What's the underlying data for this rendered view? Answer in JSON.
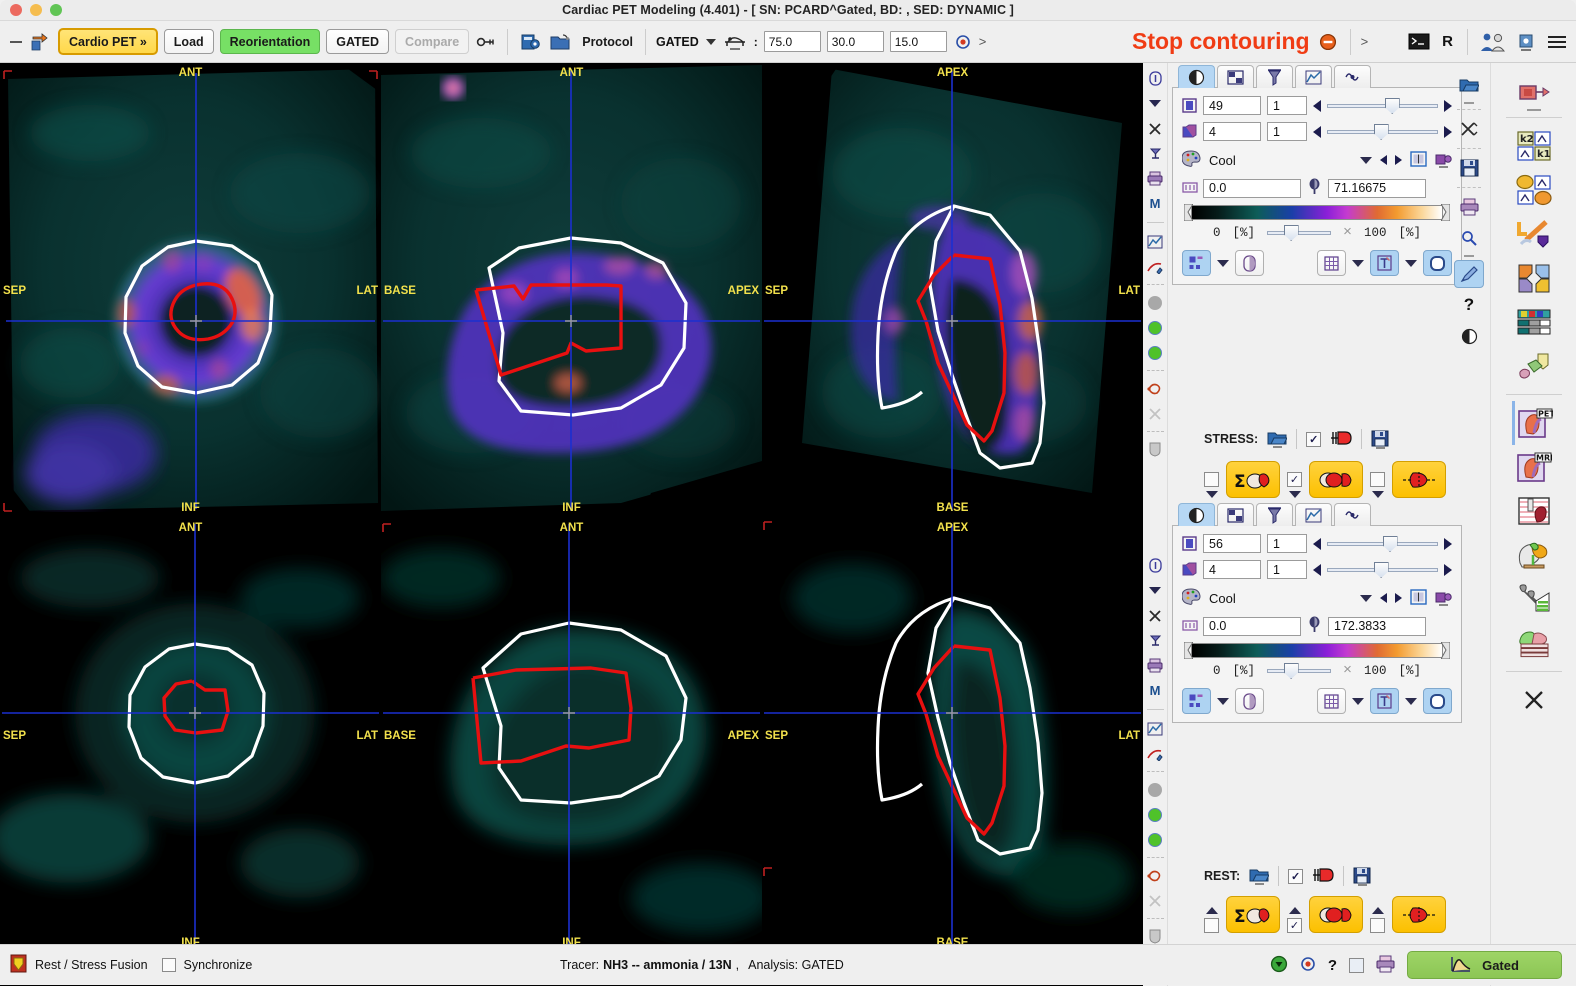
{
  "window": {
    "title": "Cardiac PET Modeling (4.401) - [ SN: PCARD^Gated, BD: , SED: DYNAMIC ]"
  },
  "toolbar": {
    "cardio_pet": "Cardio PET »",
    "load": "Load",
    "reorientation": "Reorientation",
    "gated": "GATED",
    "compare": "Compare",
    "protocol": "Protocol",
    "gated_select": "GATED",
    "colon": ":",
    "field1": "75.0",
    "field2": "30.0",
    "field3": "15.0",
    "chevron1": ">",
    "stop_contouring": "Stop contouring",
    "chevron2": ">",
    "r_label": "R",
    "icons": {
      "arrow_out": "arrow-out-icon",
      "link": "link-icon",
      "db_blue": "database-blue-icon",
      "folder_protocol": "folder-protocol-icon",
      "bed": "patient-bed-icon",
      "target": "target-icon",
      "stop": "stop-circle-icon",
      "terminal": "terminal-icon",
      "people": "people-icon",
      "help_q": "info-badge-icon",
      "hamburger": "hamburger-menu-icon"
    }
  },
  "images": {
    "row1": [
      {
        "name": "stress-short-axis",
        "top": "ANT",
        "bottom": "INF",
        "left": "SEP",
        "right": "LAT"
      },
      {
        "name": "stress-horizontal-long-axis",
        "top": "ANT",
        "bottom": "INF",
        "left": "BASE",
        "right": "APEX"
      },
      {
        "name": "stress-vertical-long-axis",
        "top": "APEX",
        "bottom": "BASE",
        "left": "SEP",
        "right": "LAT"
      }
    ],
    "row2": [
      {
        "name": "rest-short-axis",
        "top": "ANT",
        "bottom": "INF",
        "left": "SEP",
        "right": "LAT"
      },
      {
        "name": "rest-horizontal-long-axis",
        "top": "ANT",
        "bottom": "INF",
        "left": "BASE",
        "right": "APEX"
      },
      {
        "name": "rest-vertical-long-axis",
        "top": "APEX",
        "bottom": "BASE",
        "left": "SEP",
        "right": "LAT"
      }
    ]
  },
  "panel_stress": {
    "tabs": [
      "contrast-tab",
      "layout-tab",
      "filter-tab",
      "curve-tab",
      "fusion-tab"
    ],
    "active_tab_index": 0,
    "slice_value": "49",
    "slice_step": "1",
    "frame_value": "4",
    "frame_step": "1",
    "palette_name": "Cool",
    "min_value": "0.0",
    "max_value": "71.16675",
    "pct_min": "0",
    "pct_min_unit": "[%]",
    "pct_max": "100",
    "pct_max_unit": "[%]",
    "times": "×"
  },
  "panel_rest": {
    "tabs": [
      "contrast-tab",
      "layout-tab",
      "filter-tab",
      "curve-tab",
      "fusion-tab"
    ],
    "active_tab_index": 0,
    "slice_value": "56",
    "slice_step": "1",
    "frame_value": "4",
    "frame_step": "1",
    "palette_name": "Cool",
    "min_value": "0.0",
    "max_value": "172.3833",
    "pct_min": "0",
    "pct_min_unit": "[%]",
    "pct_max": "100",
    "pct_max_unit": "[%]",
    "times": "×"
  },
  "stress_row": {
    "label": "STRESS:",
    "open_icon": "folder-open-icon",
    "check_icon": "checkbox-checked-icon",
    "heart_seg_icon": "heart-segment-icon",
    "save_icon": "floppy-save-icon",
    "buttons": [
      "sum-heart-button",
      "contour-heart-button",
      "polar-heart-button"
    ]
  },
  "rest_row": {
    "label": "REST:",
    "open_icon": "folder-open-icon",
    "check_icon": "checkbox-checked-icon",
    "heart_seg_icon": "heart-segment-icon",
    "save_icon": "floppy-save-icon",
    "buttons": [
      "sum-heart-button",
      "contour-heart-button",
      "polar-heart-button"
    ]
  },
  "icon_rail": [
    "model-node-icon",
    "k2-k1-matrix-icon",
    "blob-network-icon",
    "tools-wrench-icon",
    "four-arrows-icon",
    "color-table-icon",
    "3d-shapes-icon",
    "pet-heart-icon",
    "mri-heart-icon",
    "perfusion-heart-icon",
    "brain-head-icon",
    "tree-chart-icon",
    "stack-layers-icon",
    "close-x-icon"
  ],
  "mid_rail": [
    "folder-open-icon",
    "scissors-icon",
    "floppy-save-icon",
    "printer-icon",
    "zoom-icon",
    "pen-tool-icon",
    "help-question-icon",
    "contrast-icon"
  ],
  "thin_rail": [
    "info-icon",
    "caret-down-icon",
    "close-x-icon",
    "lamp-icon",
    "printer-icon",
    "m-letter-icon",
    "curve-icon",
    "draw-icon",
    "gray-circle-icon",
    "green-circle-icon",
    "green-circle-icon",
    "contour-icon",
    "x-gray-icon",
    "shield-icon"
  ],
  "status": {
    "fusion_label": "Rest / Stress Fusion",
    "fusion_icon": "fusion-icon",
    "synchronize": "Synchronize",
    "tracer_label": "Tracer:",
    "tracer_value": "NH3 -- ammonia / 13N",
    "comma": ",",
    "analysis_label": "Analysis: GATED",
    "help": "?",
    "gated_button": "Gated",
    "icons": {
      "green_down": "green-down-circle-icon",
      "target": "target-icon",
      "checkbox": "checkbox-icon",
      "printer": "printer-icon",
      "curve": "curve-icon"
    }
  },
  "colors": {
    "accent_gold": "#fcc000",
    "accent_green": "#77e065",
    "alert_red": "#f03c14",
    "label_yellow": "#f2e14c",
    "contour_white": "#ffffff",
    "contour_red": "#e81010",
    "crosshair_blue": "#1b2fd0",
    "selected_blue": "#aed3f2"
  }
}
